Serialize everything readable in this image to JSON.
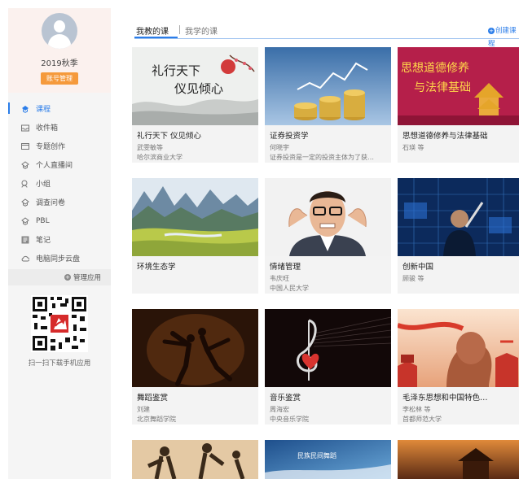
{
  "profile": {
    "username": "2019秋季",
    "account_label": "账号管理"
  },
  "nav": [
    {
      "label": "课程",
      "icon": "course-icon",
      "active": true
    },
    {
      "label": "收件箱",
      "icon": "inbox-icon"
    },
    {
      "label": "专题创作",
      "icon": "topic-icon"
    },
    {
      "label": "个人直播间",
      "icon": "live-icon"
    },
    {
      "label": "小组",
      "icon": "group-icon"
    },
    {
      "label": "调查问卷",
      "icon": "survey-icon"
    },
    {
      "label": "PBL",
      "icon": "pbl-icon"
    },
    {
      "label": "笔记",
      "icon": "note-icon"
    },
    {
      "label": "电脑同步云盘",
      "icon": "cloud-icon"
    }
  ],
  "manage_label": "管理应用",
  "qr_caption": "扫一扫下载手机应用",
  "tabs": {
    "teaching": "我教的课",
    "learning": "我学的课"
  },
  "create_label": "创建课程",
  "thumb_texts": {
    "etiquette_1": "礼行天下",
    "etiquette_2": "仪见倾心",
    "ideology_1": "思想道德修养",
    "ideology_2": "与法律基础",
    "folk": "民族民间舞蹈"
  },
  "courses": [
    {
      "title": "礼行天下 仪见倾心",
      "teacher": "武雯敏等",
      "school": "哈尔滨商业大学"
    },
    {
      "title": "证券投资学",
      "teacher": "何晓宇",
      "school": "证券投资是一定的投资主体为了获…"
    },
    {
      "title": "思想道德修养与法律基础",
      "teacher": "石瑛 等",
      "school": ""
    },
    {
      "title": "环境生态学",
      "teacher": "",
      "school": ""
    },
    {
      "title": "情绪管理",
      "teacher": "韦庆旺",
      "school": "中国人民大学"
    },
    {
      "title": "创新中国",
      "teacher": "顾骏 等",
      "school": ""
    },
    {
      "title": "舞蹈鉴赏",
      "teacher": "刘建",
      "school": "北京舞蹈学院"
    },
    {
      "title": "音乐鉴赏",
      "teacher": "周海宏",
      "school": "中央音乐学院"
    },
    {
      "title": "毛泽东思想和中国特色…",
      "teacher": "李松林 等",
      "school": "首都师范大学"
    }
  ]
}
